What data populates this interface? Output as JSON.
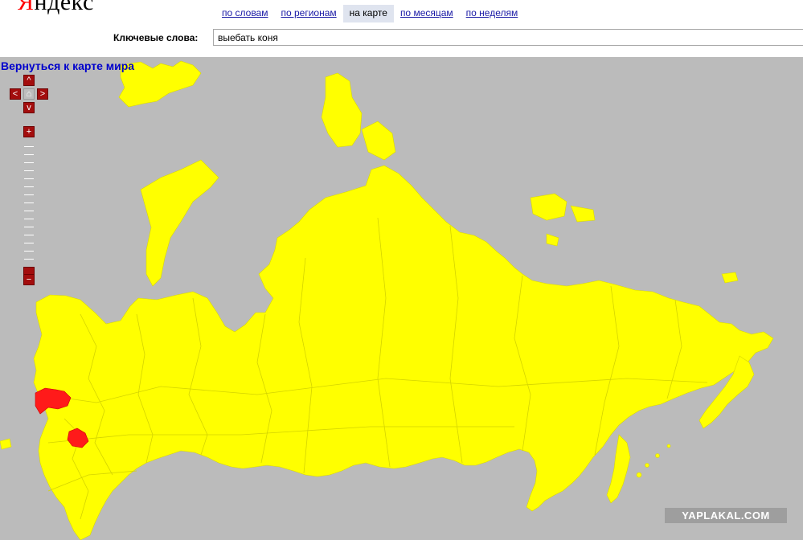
{
  "header": {
    "logo_first": "Я",
    "logo_rest": "ндекс",
    "tabs": [
      {
        "label": "по словам",
        "active": false
      },
      {
        "label": "по регионам",
        "active": false
      },
      {
        "label": "на карте",
        "active": true
      },
      {
        "label": "по месяцам",
        "active": false
      },
      {
        "label": "по неделям",
        "active": false
      }
    ],
    "keywords_label": "Ключевые слова:",
    "keywords_value": "выебать коня"
  },
  "map": {
    "back_link": "Вернуться к карте мира",
    "highlight_color": "#ff1a1a",
    "land_color": "#ffff00",
    "water_color": "#bbbbbb",
    "highlighted_regions": 2,
    "controls": {
      "up": "^",
      "down": "v",
      "left": "<",
      "right": ">",
      "home": "⌂",
      "zoom_in": "+",
      "zoom_out": "−"
    },
    "watermark": "YAPLAKAL.COM"
  }
}
